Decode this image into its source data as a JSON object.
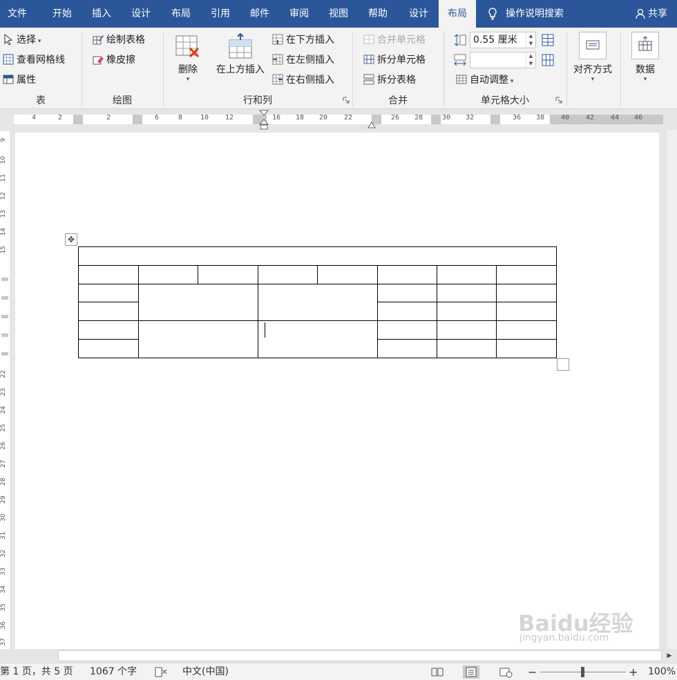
{
  "tabs": [
    "文件",
    "开始",
    "插入",
    "设计",
    "布局",
    "引用",
    "邮件",
    "审阅",
    "视图",
    "帮助",
    "设计",
    "布局"
  ],
  "active_tab_index": 11,
  "tell_me": "操作说明搜索",
  "share": "共享",
  "ribbon": {
    "table_group": {
      "label": "表",
      "select": "选择",
      "gridlines": "查看网格线",
      "properties": "属性"
    },
    "draw_group": {
      "label": "绘图",
      "draw_table": "绘制表格",
      "eraser": "橡皮擦"
    },
    "rows_cols_group": {
      "label": "行和列",
      "delete": "删除",
      "insert_above": "在上方插入",
      "insert_below": "在下方插入",
      "insert_left": "在左侧插入",
      "insert_right": "在右侧插入"
    },
    "merge_group": {
      "label": "合并",
      "merge_cells": "合并单元格",
      "split_cells": "拆分单元格",
      "split_table": "拆分表格"
    },
    "cell_size_group": {
      "label": "单元格大小",
      "height_value": "0.55 厘米",
      "width_value": "",
      "autofit": "自动调整"
    },
    "align": {
      "label": "对齐方式"
    },
    "data": {
      "label": "数据"
    }
  },
  "ruler_numbers": [
    "4",
    "2",
    "2",
    "6",
    "8",
    "10",
    "12",
    "16",
    "18",
    "20",
    "22",
    "26",
    "28",
    "30",
    "32",
    "36",
    "38",
    "40",
    "42",
    "44",
    "46"
  ],
  "vruler_numbers": [
    "9",
    "10",
    "11",
    "12",
    "13",
    "14",
    "15",
    "22",
    "23",
    "24",
    "25",
    "26",
    "27",
    "28",
    "29",
    "30",
    "31",
    "32",
    "33",
    "34",
    "35",
    "36",
    "37"
  ],
  "status": {
    "page": "第 1 页，共 5 页",
    "words": "1067 个字",
    "language": "中文(中国)",
    "zoom": "100%"
  },
  "watermark": {
    "brand": "Baidu经验",
    "url": "jingyan.baidu.com"
  },
  "colors": {
    "accent": "#2b579a",
    "ribbon_bg": "#f3f3f3",
    "canvas_bg": "#e6e6e6"
  }
}
